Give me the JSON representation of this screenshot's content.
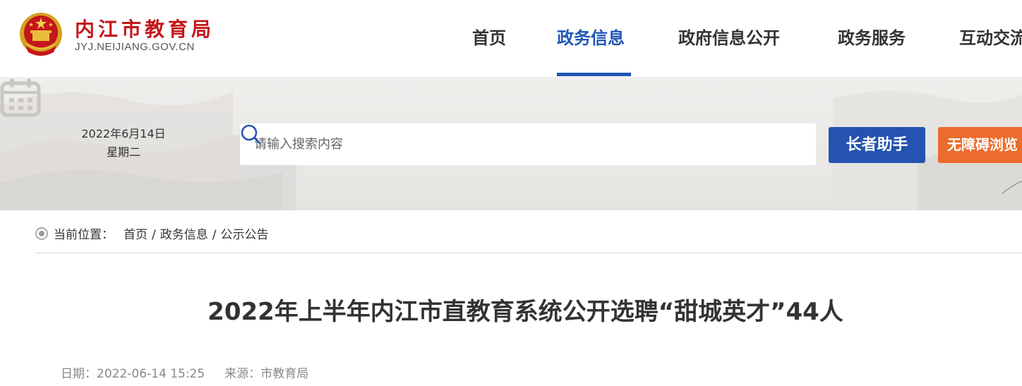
{
  "site": {
    "title": "内江市教育局",
    "domain": "JYJ.NEIJIANG.GOV.CN"
  },
  "nav": {
    "items": [
      {
        "label": "首页",
        "active": false
      },
      {
        "label": "政务信息",
        "active": true
      },
      {
        "label": "政府信息公开",
        "active": false
      },
      {
        "label": "政务服务",
        "active": false
      },
      {
        "label": "互动交流",
        "active": false
      }
    ]
  },
  "toolbar": {
    "date": "2022年6月14日",
    "weekday": "星期二",
    "search_placeholder": "请输入搜索内容",
    "elder_button": "长者助手",
    "accessibility_button": "无障碍浏览"
  },
  "breadcrumb": {
    "label": "当前位置：",
    "items": [
      "首页",
      "政务信息",
      "公示公告"
    ],
    "separator": "/"
  },
  "article": {
    "title": "2022年上半年内江市直教育系统公开选聘“甜城英才”44人",
    "date_label": "日期：",
    "date": "2022-06-14 15:25",
    "source_label": "来源：",
    "source": "市教育局"
  },
  "colors": {
    "brand_red": "#c4161c",
    "nav_active": "#1e56b3",
    "elder_button": "#2453b0",
    "accessibility_button": "#eb6c2c"
  },
  "icons": [
    "national-emblem-icon",
    "calendar-icon",
    "search-icon",
    "location-dot-icon"
  ]
}
